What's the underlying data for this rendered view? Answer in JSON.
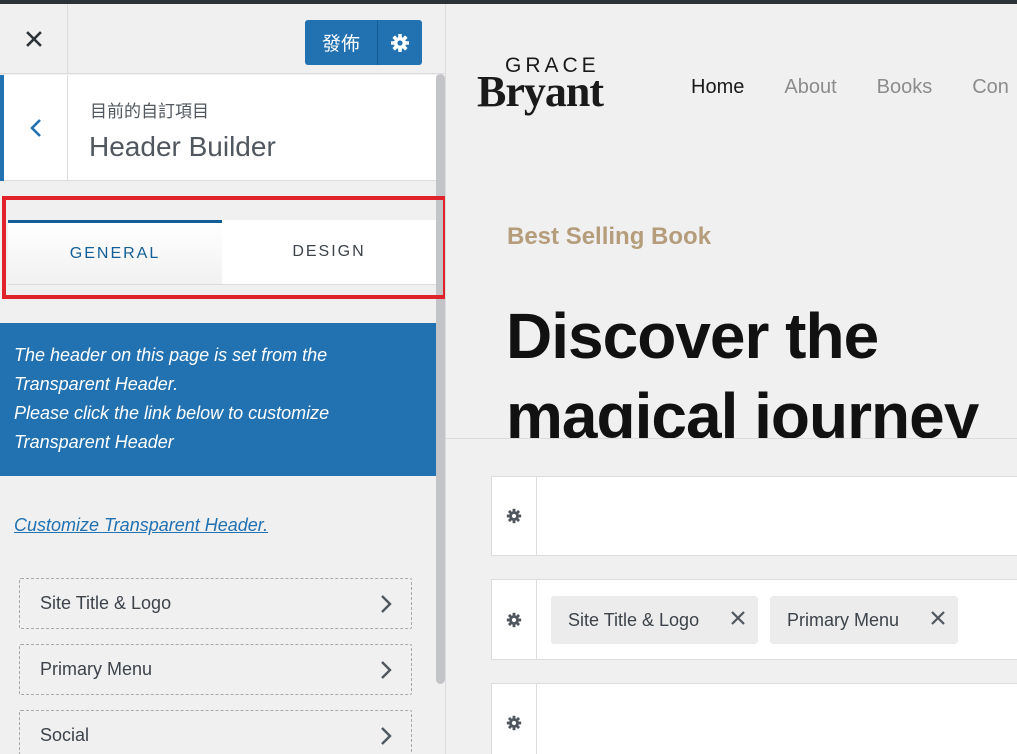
{
  "customizer": {
    "publish_label": "發佈",
    "breadcrumb": "目前的自訂項目",
    "section_title": "Header Builder",
    "tabs": [
      {
        "label": "GENERAL",
        "active": true
      },
      {
        "label": "DESIGN",
        "active": false
      }
    ],
    "notice_lines": [
      "The header on this page is set from the",
      "Transparent Header.",
      "Please click the link below to customize",
      "Transparent Header"
    ],
    "customize_link": "Customize Transparent Header.",
    "items": [
      {
        "label": "Site Title & Logo"
      },
      {
        "label": "Primary Menu"
      },
      {
        "label": "Social"
      }
    ]
  },
  "preview": {
    "logo_top": "GRACE",
    "logo_main": "Bryant",
    "nav": [
      "Home",
      "About",
      "Books",
      "Con"
    ],
    "eyebrow": "Best Selling Book",
    "hero_lines": [
      "Discover the",
      "magical journey"
    ],
    "builder_chips": [
      "Site Title & Logo",
      "Primary Menu"
    ]
  },
  "colors": {
    "accent": "#2271b1",
    "highlight": "#e0222b",
    "eyebrow": "#b59d7c"
  }
}
